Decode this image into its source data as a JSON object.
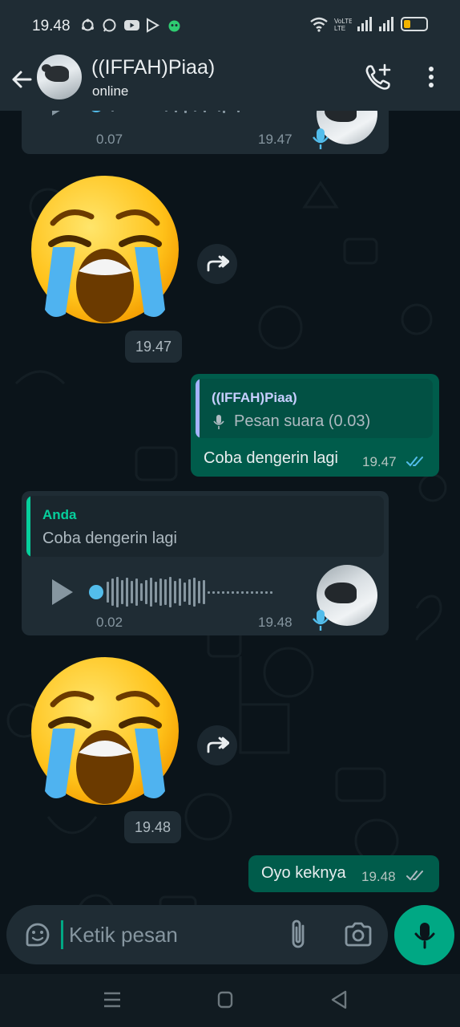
{
  "status_bar": {
    "time": "19.48",
    "network_label": "VoLTE",
    "battery_level": 0.3
  },
  "header": {
    "contact_name": "((IFFAH)Piaa)",
    "contact_status": "online"
  },
  "messages": {
    "top_voice": {
      "duration": "0.07",
      "time": "19.47"
    },
    "sticker1": {
      "emoji": "loudly-crying-face",
      "time": "19.47"
    },
    "reply_out": {
      "quote_name": "((IFFAH)Piaa)",
      "quote_text": "Pesan suara (0.03)",
      "text": "Coba dengerin lagi",
      "time": "19.47"
    },
    "voice_in": {
      "quote_name": "Anda",
      "quote_text": "Coba dengerin lagi",
      "duration": "0.02",
      "time": "19.48"
    },
    "sticker2": {
      "emoji": "loudly-crying-face",
      "time": "19.48"
    },
    "last_out": {
      "text": "Oyo keknya",
      "time": "19.48"
    }
  },
  "input": {
    "placeholder": "Ketik pesan"
  },
  "colors": {
    "accent": "#00a884",
    "outgoing_bubble": "#005c4b",
    "incoming_bubble": "#1f2c34",
    "read_ticks": "#53bdeb",
    "background": "#0b141a"
  }
}
